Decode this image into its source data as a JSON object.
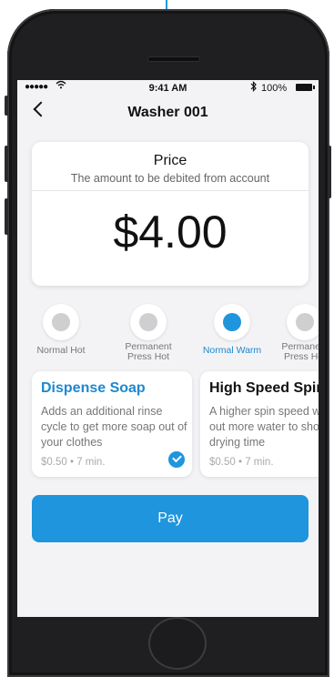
{
  "status_bar": {
    "signal": "●●●●●",
    "time": "9:41 AM",
    "battery": "100%"
  },
  "header": {
    "title": "Washer 001",
    "back_icon": "chevron-left-icon"
  },
  "price_card": {
    "title": "Price",
    "subtitle": "The amount to be debited from account",
    "amount": "$4.00"
  },
  "cycle_options": [
    {
      "label": "Normal Hot",
      "selected": false
    },
    {
      "label": "Permanent Press Hot",
      "selected": false
    },
    {
      "label": "Normal Warm",
      "selected": true
    },
    {
      "label": "Permanent Press Hot",
      "selected": false
    }
  ],
  "addons": [
    {
      "title": "Dispense Soap",
      "description": "Adds an additional rinse cycle to get more soap out of your clothes",
      "meta": "$0.50 • 7 min.",
      "selected": true,
      "title_color": "#1e88cf"
    },
    {
      "title": "High Speed Spin",
      "description": "A higher spin speed will get out more water to shorten drying time",
      "meta": "$0.50 • 7 min.",
      "selected": false,
      "title_color": "#111111"
    }
  ],
  "pay_button": {
    "label": "Pay"
  },
  "colors": {
    "accent": "#1e95dc",
    "screen_bg": "#f3f3f5",
    "phone_body": "#1f1f21"
  }
}
